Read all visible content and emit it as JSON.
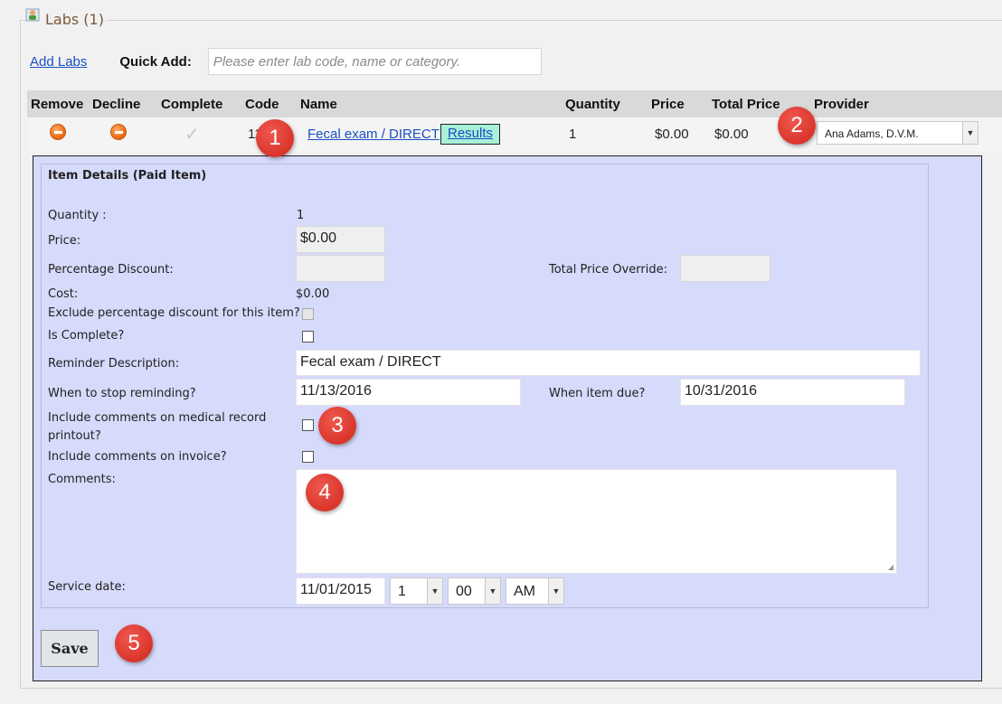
{
  "section": {
    "title": "Labs (1)",
    "icon": "lab-user-icon"
  },
  "toolbar": {
    "add_labs": "Add Labs",
    "quick_add_label": "Quick Add:",
    "quick_add_placeholder": "Please enter lab code, name or category."
  },
  "table": {
    "headers": [
      "Remove",
      "Decline",
      "Complete",
      "Code",
      "Name",
      "Quantity",
      "Price",
      "Total Price",
      "Provider"
    ],
    "row": {
      "remove_icon": "minus-circle-icon",
      "decline_icon": "minus-circle-icon",
      "complete_icon": "checkmark-icon",
      "code": "11",
      "name": "Fecal exam / DIRECT",
      "results": "Results",
      "quantity": "1",
      "price": "$0.00",
      "total_price": "$0.00",
      "provider": "Ana Adams, D.V.M."
    }
  },
  "details": {
    "title": "Item Details (Paid Item)",
    "quantity_label": "Quantity :",
    "quantity": "1",
    "price_label": "Price:",
    "price": "$0.00",
    "pct_discount_label": "Percentage Discount:",
    "pct_discount": "",
    "total_override_label": "Total Price Override:",
    "total_override": "",
    "cost_label": "Cost:",
    "cost": "$0.00",
    "exclude_label": "Exclude percentage discount for this item?",
    "is_complete_label": "Is Complete?",
    "reminder_label": "Reminder Description:",
    "reminder": "Fecal exam / DIRECT",
    "stop_label": "When to stop reminding?",
    "stop": "11/13/2016",
    "due_label": "When item due?",
    "due": "10/31/2016",
    "include_medical_label_1": "Include comments on medical record",
    "include_medical_label_2": "printout?",
    "include_invoice_label": "Include comments on invoice?",
    "comments_label": "Comments:",
    "comments": "",
    "service_label": "Service date:",
    "service_date": "11/01/2015",
    "hour": "1",
    "minute": "00",
    "ampm": "AM",
    "save": "Save"
  },
  "badges": [
    "1",
    "2",
    "3",
    "4",
    "5"
  ],
  "colors": {
    "panel": "#d6dafb",
    "header": "#d9d9d9",
    "badge": "#d9352b",
    "link": "#1a4fc4",
    "results_bg": "#a8f0d8"
  }
}
